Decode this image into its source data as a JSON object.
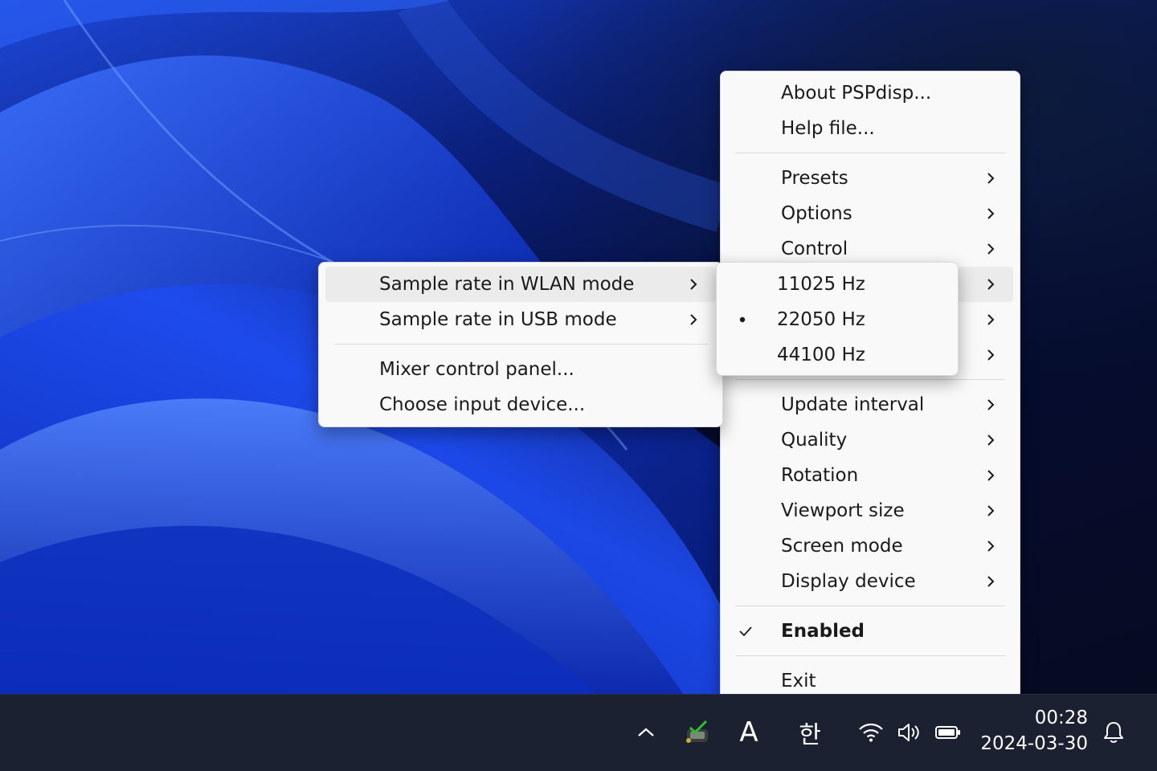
{
  "main_menu": {
    "items_top": [
      {
        "label": "About PSPdisp..."
      },
      {
        "label": "Help file..."
      }
    ],
    "items_group1": [
      {
        "label": "Presets"
      },
      {
        "label": "Options"
      },
      {
        "label": "Control"
      },
      {
        "label": ""
      },
      {
        "label": ""
      },
      {
        "label": ""
      }
    ],
    "items_group2": [
      {
        "label": "Update interval"
      },
      {
        "label": "Quality"
      },
      {
        "label": "Rotation"
      },
      {
        "label": "Viewport size"
      },
      {
        "label": "Screen mode"
      },
      {
        "label": "Display device"
      }
    ],
    "enabled": {
      "label": "Enabled",
      "checked": true
    },
    "exit": {
      "label": "Exit"
    }
  },
  "audio_submenu": {
    "items": [
      {
        "label": "Sample rate in WLAN mode",
        "highlighted": true
      },
      {
        "label": "Sample rate in USB mode"
      }
    ],
    "actions": [
      {
        "label": "Mixer control panel..."
      },
      {
        "label": "Choose input device..."
      }
    ]
  },
  "sample_rate_submenu": {
    "items": [
      {
        "label": "11025 Hz",
        "selected": false
      },
      {
        "label": "22050 Hz",
        "selected": true
      },
      {
        "label": "44100 Hz",
        "selected": false
      }
    ]
  },
  "taskbar": {
    "tray_icons": [
      "chevron-up-icon",
      "pspdisp-icon",
      "ime-a-icon",
      "ime-korean-icon",
      "wifi-icon",
      "volume-icon",
      "battery-icon",
      "bell-icon"
    ],
    "ime_label": "A",
    "korean_label": "한",
    "time": "00:28",
    "date": "2024-03-30"
  }
}
